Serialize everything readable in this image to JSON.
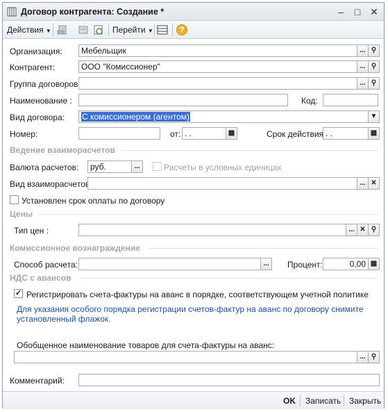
{
  "window": {
    "title": "Договор контрагента: Создание *",
    "controls": {
      "minimize": "–",
      "maximize": "□",
      "close": "✕"
    }
  },
  "toolbar": {
    "actions_label": "Действия",
    "goto_label": "Перейти",
    "help_icon": "?"
  },
  "form": {
    "organization": {
      "label": "Организация:",
      "value": "Мебельщик"
    },
    "counterparty": {
      "label": "Контрагент:",
      "value": "ООО \"Комиссионер\""
    },
    "contract_group": {
      "label": "Группа договоров:",
      "value": ""
    },
    "name": {
      "label": "Наименование :",
      "value": ""
    },
    "code": {
      "label": "Код:",
      "value": ""
    },
    "contract_type": {
      "label": "Вид договора:",
      "value": "С комиссионером (агентом)"
    },
    "number": {
      "label": "Номер:",
      "value": ""
    },
    "date_from": {
      "label": "от:",
      "value": " .  ."
    },
    "validity": {
      "label": "Срок действия:",
      "value": " .  ."
    }
  },
  "settlements": {
    "section_title": "Ведение взаиморасчетов",
    "currency": {
      "label": "Валюта расчетов:",
      "value": "руб."
    },
    "conventional_units": {
      "label": "Расчеты в условных единицах",
      "checked": false
    },
    "settlement_type": {
      "label": "Вид взаиморасчетов:",
      "value": ""
    },
    "payment_term": {
      "label": "Установлен срок оплаты по договору",
      "checked": false
    }
  },
  "prices": {
    "section_title": "Цены",
    "price_type": {
      "label": "Тип цен :",
      "value": ""
    }
  },
  "commission": {
    "section_title": "Комиссионное вознаграждение",
    "calc_method": {
      "label": "Способ расчета:",
      "value": ""
    },
    "percent": {
      "label": "Процент:",
      "value": "0,00"
    }
  },
  "vat": {
    "section_title": "НДС с авансов",
    "register_invoices": {
      "label": "Регистрировать счета-фактуры на аванс в порядке, соответствующем учетной политике",
      "checked": true
    },
    "note": "Для указания особого порядка регистрации счетов-фактур на аванс по договору снимите установленный флажок.",
    "goods_name": {
      "label": "Обобщенное наименование товаров для счета-фактуры на аванс:",
      "value": ""
    }
  },
  "comment": {
    "label": "Комментарий:",
    "value": ""
  },
  "bottom": {
    "ok": "OK",
    "save": "Записать",
    "close": "Закрыть"
  }
}
